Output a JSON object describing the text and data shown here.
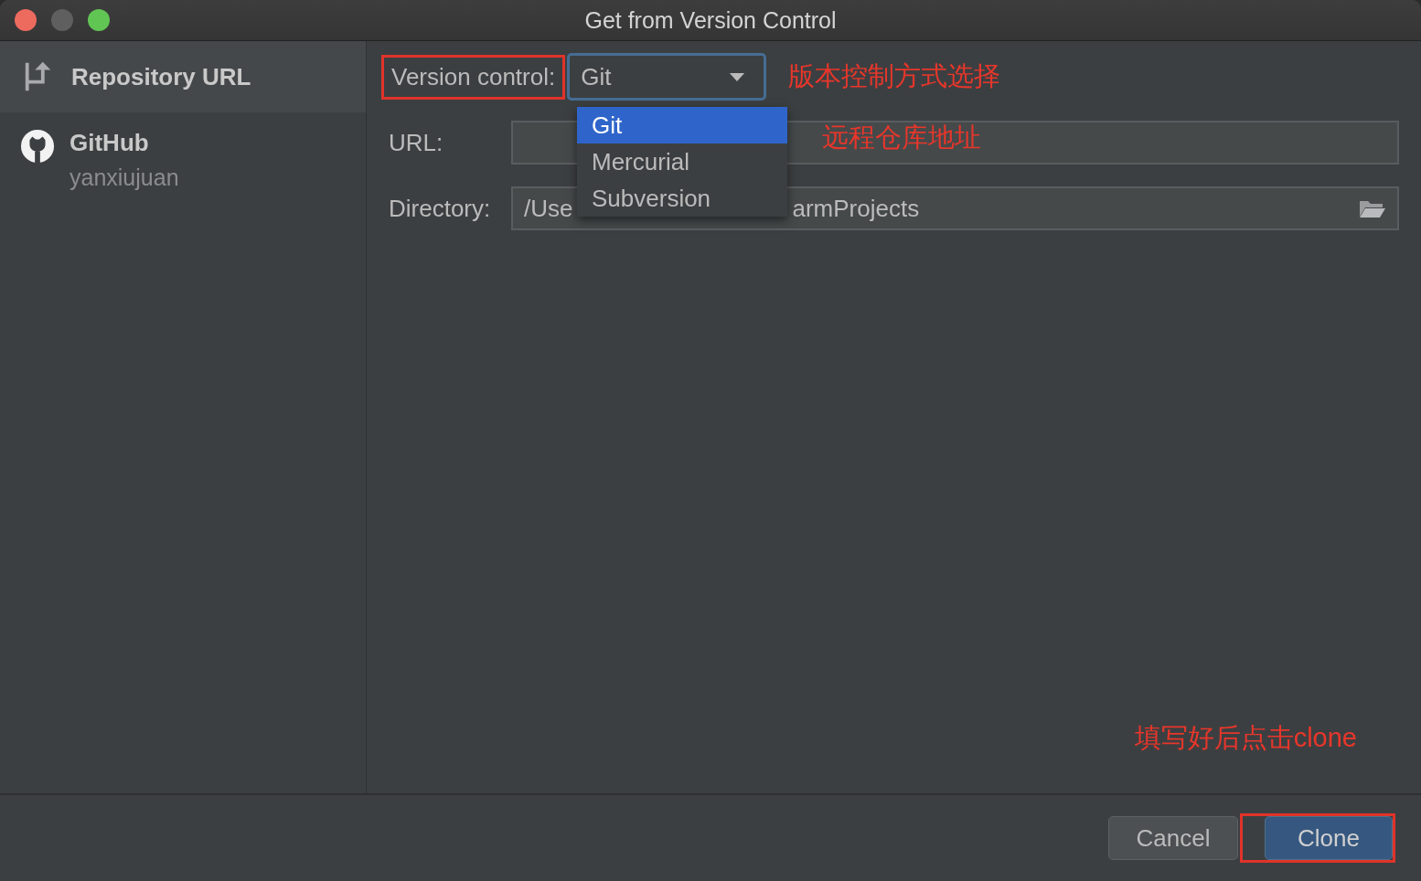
{
  "window": {
    "title": "Get from Version Control"
  },
  "sidebar": {
    "items": [
      {
        "kind": "url",
        "label": "Repository URL",
        "selected": true
      },
      {
        "kind": "github",
        "label": "GitHub",
        "account": "yanxiujuan",
        "selected": false
      }
    ]
  },
  "form": {
    "version_control": {
      "label": "Version control:",
      "highlighted": true,
      "value": "Git",
      "annotation": "版本控制方式选择",
      "options": [
        {
          "label": "Git",
          "selected": true
        },
        {
          "label": "Mercurial",
          "selected": false
        },
        {
          "label": "Subversion",
          "selected": false
        }
      ]
    },
    "url": {
      "label": "URL:",
      "annotation": "远程仓库地址"
    },
    "directory": {
      "label": "Directory:",
      "value_parts": [
        "/Use",
        "armProjects"
      ]
    }
  },
  "annotation": "填写好后点击clone",
  "buttons": [
    {
      "kind": "secondary",
      "label": "Cancel",
      "highlighted": false
    },
    {
      "kind": "primary",
      "label": "Clone",
      "highlighted": true
    }
  ]
}
